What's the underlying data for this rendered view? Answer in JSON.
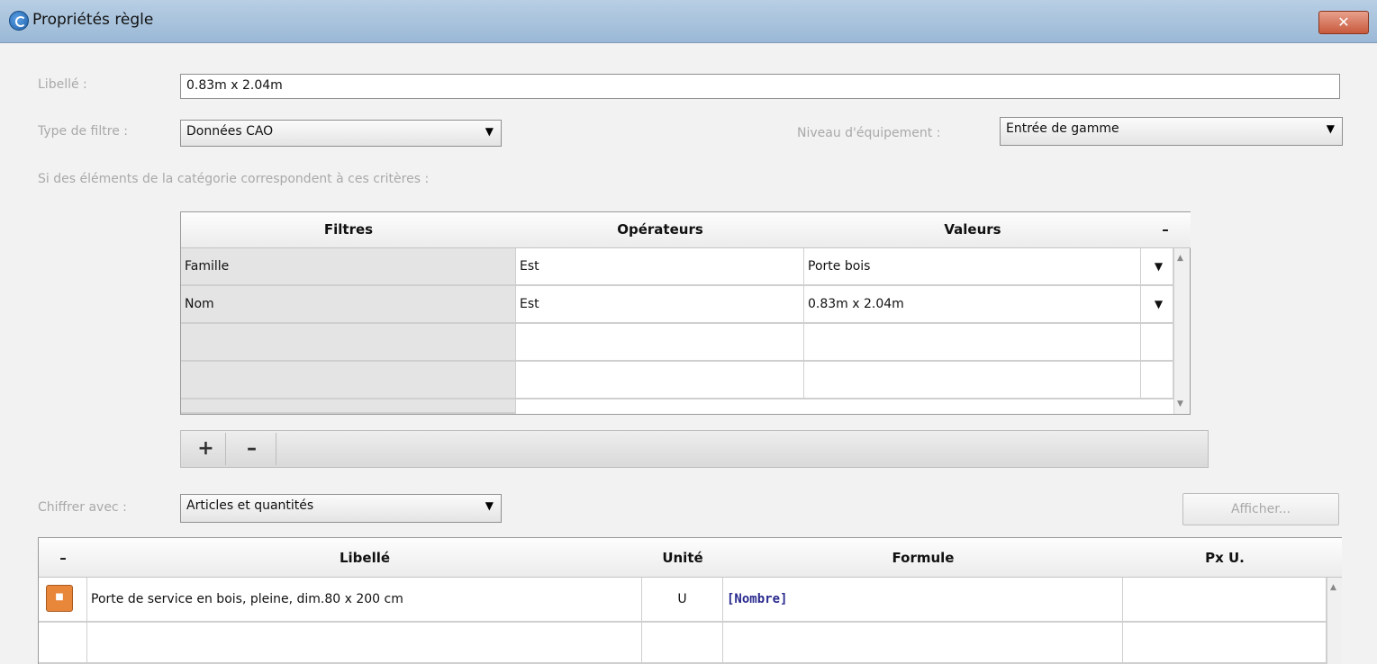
{
  "window": {
    "title": "Propriétés règle",
    "close_label": "✕"
  },
  "form": {
    "libelle_label": "Libellé :",
    "libelle_value": "0.83m x 2.04m",
    "type_filtre_label": "Type de filtre :",
    "type_filtre_value": "Données CAO",
    "niveau_label": "Niveau d'équipement :",
    "niveau_value": "Entrée de gamme",
    "criteria_text": "Si des éléments de la catégorie correspondent à ces critères :",
    "chiffrer_label": "Chiffrer avec :",
    "chiffrer_value": "Articles et quantités",
    "afficher_button": "Afficher..."
  },
  "filters": {
    "headers": [
      "Filtres",
      "Opérateurs",
      "Valeurs"
    ],
    "collapse_label": "–",
    "rows": [
      {
        "filtre": "Famille",
        "operateur": "Est",
        "valeur": "Porte bois"
      },
      {
        "filtre": "Nom",
        "operateur": "Est",
        "valeur": "0.83m x 2.04m"
      }
    ],
    "add_label": "+",
    "remove_label": "–"
  },
  "articles": {
    "headers": [
      "Libellé",
      "Unité",
      "Formule",
      "Px U."
    ],
    "collapse_label": "–",
    "rows": [
      {
        "icon": "article-icon",
        "libelle": "Porte de service en bois, pleine, dim.80 x 200 cm",
        "unite": "U",
        "formule": "[Nombre]",
        "px": ""
      }
    ]
  },
  "icons": {
    "app": "app-logo-icon",
    "dropdown": "chevron-down-icon",
    "scroll_up": "scroll-up-icon",
    "scroll_down": "scroll-down-icon"
  }
}
